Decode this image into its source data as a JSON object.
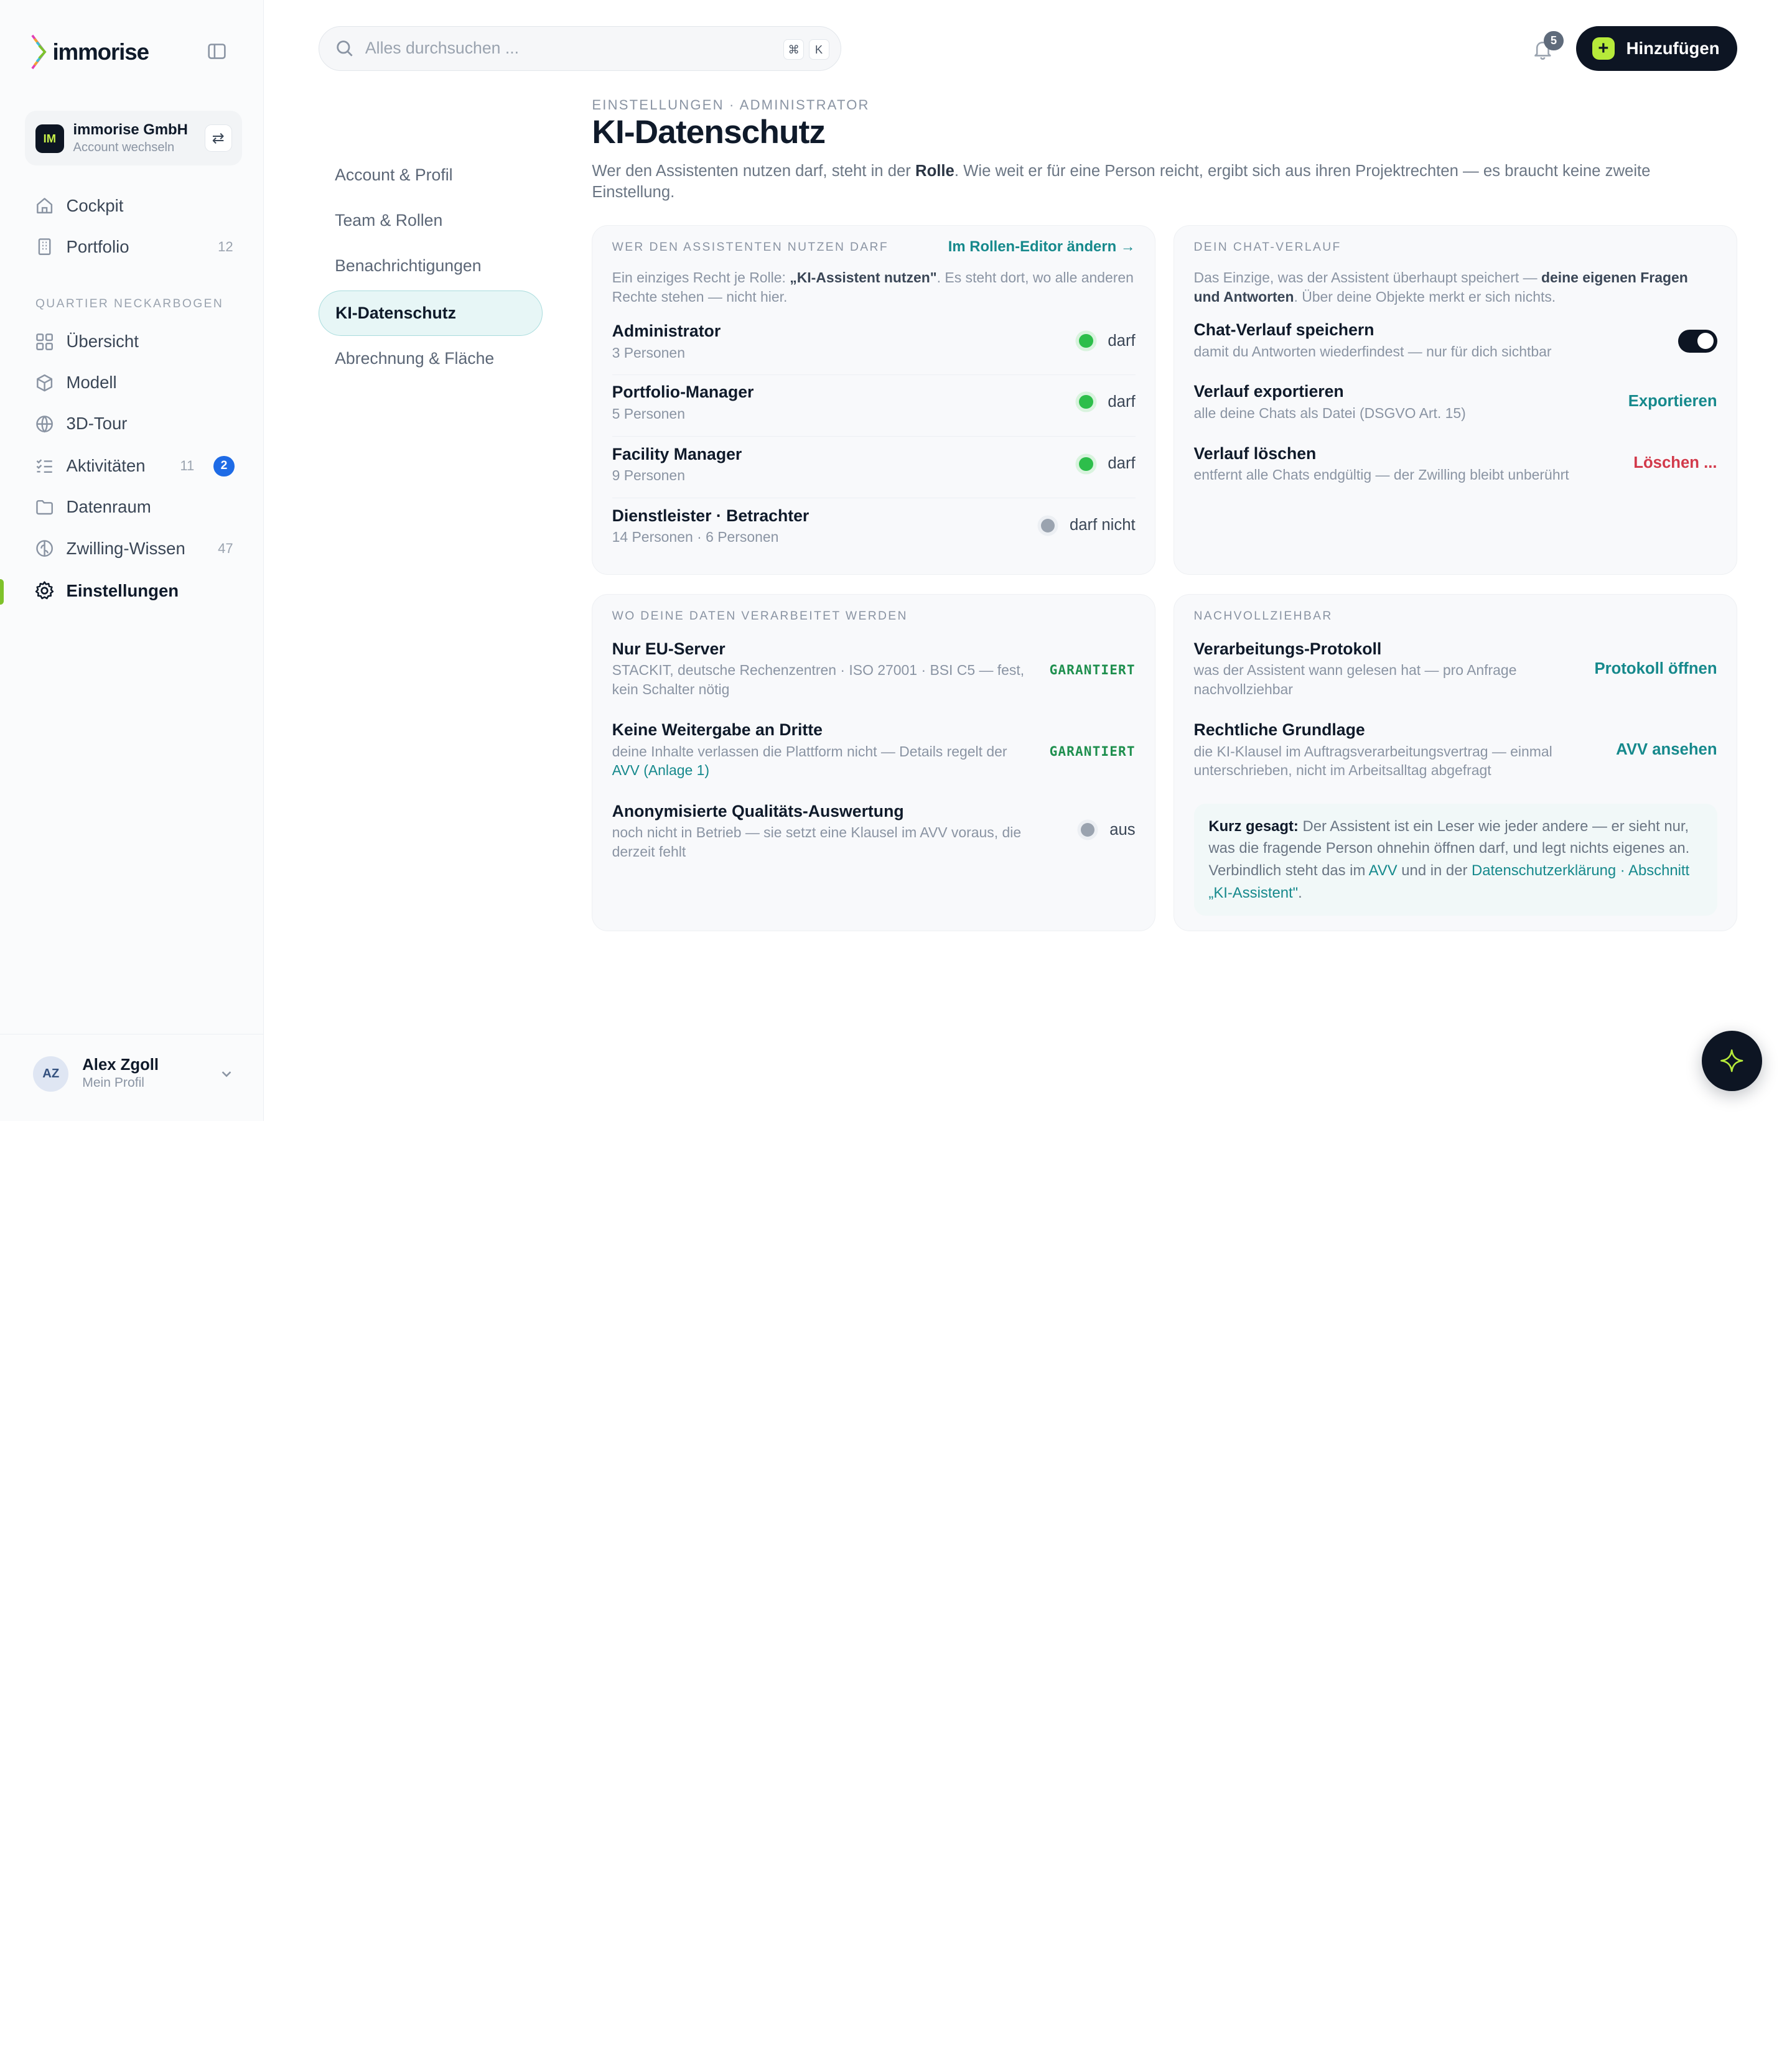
{
  "brand": {
    "name": "immorise"
  },
  "account": {
    "initials": "IM",
    "name": "immorise GmbH",
    "switch_label": "Account wechseln"
  },
  "nav": [
    {
      "label": "Cockpit",
      "icon": "home-icon",
      "count": ""
    },
    {
      "label": "Portfolio",
      "icon": "building-icon",
      "count": "12"
    }
  ],
  "nav_section": "QUARTIER NECKARBOGEN",
  "nav_quartier": [
    {
      "label": "Übersicht",
      "icon": "grid-icon",
      "count": ""
    },
    {
      "label": "Modell",
      "icon": "cube-icon",
      "count": ""
    },
    {
      "label": "3D-Tour",
      "icon": "globe-icon",
      "count": ""
    },
    {
      "label": "Aktivitäten",
      "icon": "checklist-icon",
      "count": "11",
      "badge": "2"
    },
    {
      "label": "Datenraum",
      "icon": "folder-icon",
      "count": ""
    },
    {
      "label": "Zwilling-Wissen",
      "icon": "brain-icon",
      "count": "47"
    },
    {
      "label": "Einstellungen",
      "icon": "gear-icon",
      "count": "",
      "active": true
    }
  ],
  "user": {
    "initials": "AZ",
    "name": "Alex Zgoll",
    "sub": "Mein Profil"
  },
  "search": {
    "placeholder": "Alles durchsuchen ...",
    "kbd1": "⌘",
    "kbd2": "K"
  },
  "notifications": {
    "count": "5"
  },
  "add_button": {
    "label": "Hinzufügen"
  },
  "subnav": [
    {
      "label": "Account & Profil"
    },
    {
      "label": "Team & Rollen"
    },
    {
      "label": "Benachrichtigungen"
    },
    {
      "label": "KI-Datenschutz",
      "active": true
    },
    {
      "label": "Abrechnung & Fläche"
    }
  ],
  "header": {
    "crumb": "EINSTELLUNGEN · ADMINISTRATOR",
    "title": "KI-Datenschutz",
    "desc_1": "Wer den Assistenten nutzen darf, steht in der ",
    "desc_bold": "Rolle",
    "desc_2": ". Wie weit er für eine Person reicht, ergibt sich aus ihren Projektrechten — es braucht keine zweite Einstellung."
  },
  "card_users": {
    "label": "WER DEN ASSISTENTEN NUTZEN DARF",
    "link": "Im Rollen-Editor ändern →",
    "intro_1": "Ein einziges Recht je Rolle: ",
    "intro_bold": "„KI-Assistent nutzen\"",
    "intro_2": ". Es steht dort, wo alle anderen Rechte stehen — nicht hier.",
    "rows": [
      {
        "title": "Administrator",
        "sub": "3 Personen",
        "status": "darf",
        "allowed": true
      },
      {
        "title": "Portfolio-Manager",
        "sub": "5 Personen",
        "status": "darf",
        "allowed": true
      },
      {
        "title": "Facility Manager",
        "sub": "9 Personen",
        "status": "darf",
        "allowed": true
      },
      {
        "title": "Dienstleister · Betrachter",
        "sub": "14 Personen · 6 Personen",
        "status": "darf nicht",
        "allowed": false
      }
    ]
  },
  "card_history": {
    "label": "DEIN CHAT-VERLAUF",
    "intro_1": "Das Einzige, was der Assistent überhaupt speichert — ",
    "intro_bold": "deine eigenen Fragen und Antworten",
    "intro_2": ". Über deine Objekte merkt er sich nichts.",
    "rows": [
      {
        "title": "Chat-Verlauf speichern",
        "sub": "damit du Antworten wiederfindest — nur für dich sichtbar",
        "toggle": true
      },
      {
        "title": "Verlauf exportieren",
        "sub": "alle deine Chats als Datei (DSGVO Art. 15)",
        "action": "Exportieren"
      },
      {
        "title": "Verlauf löschen",
        "sub": "entfernt alle Chats endgültig — der Zwilling bleibt unberührt",
        "action": "Löschen ..."
      }
    ]
  },
  "card_data": {
    "label": "WO DEINE DATEN VERARBEITET WERDEN",
    "rows": [
      {
        "title": "Nur EU-Server",
        "sub": "STACKIT, deutsche Rechenzentren · ISO 27001 · BSI C5 — fest, kein Schalter nötig",
        "status": "GARANTIERT"
      },
      {
        "title": "Keine Weitergabe an Dritte",
        "sub": "deine Inhalte verlassen die Plattform nicht — Details regelt der ",
        "sub_link": "AVV (Anlage 1)",
        "status": "GARANTIERT"
      },
      {
        "title": "Anonymisierte Qualitäts-Auswertung",
        "sub": "noch nicht in Betrieb — sie setzt eine Klausel im AVV voraus, die derzeit fehlt",
        "status": "aus"
      }
    ]
  },
  "card_trace": {
    "label": "NACHVOLLZIEHBAR",
    "rows": [
      {
        "title": "Verarbeitungs-Protokoll",
        "sub": "was der Assistent wann gelesen hat — pro Anfrage nachvollziehbar",
        "action": "Protokoll öffnen"
      },
      {
        "title": "Rechtliche Grundlage",
        "sub": "die KI-Klausel im Auftragsverarbeitungsvertrag — einmal unterschrieben, nicht im Arbeitsalltag abgefragt",
        "action": "AVV ansehen"
      }
    ],
    "note": {
      "bold": "Kurz gesagt:",
      "text_1": " Der Assistent ist ein Leser wie jeder andere — er sieht nur, was die fragende Person ohnehin öffnen darf, und legt nichts eigenes an. Verbindlich steht das im ",
      "link_1": "AVV",
      "text_2": " und in der ",
      "link_2": "Datenschutzerklärung · Abschnitt „KI-Assistent\"",
      "text_3": "."
    }
  },
  "colors": {
    "accent": "#16898c",
    "dark": "#0d1523",
    "lime": "#b6ea3a",
    "green": "#2dbe4b",
    "red": "#d23a4b"
  }
}
